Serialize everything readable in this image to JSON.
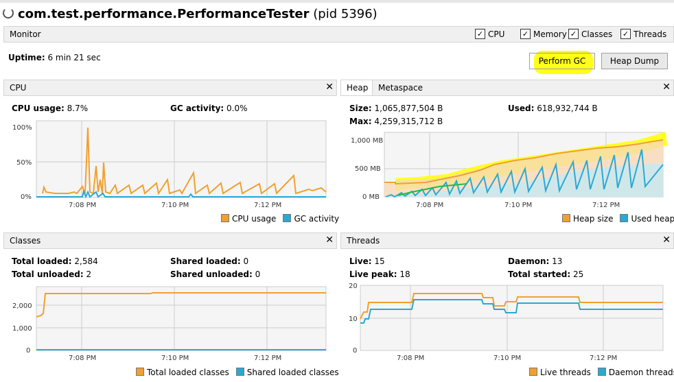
{
  "window": {
    "process": "com.test.performance.PerformanceTester",
    "pid": "(pid 5396)"
  },
  "monitor": {
    "label": "Monitor",
    "checkboxes": [
      {
        "label": "CPU",
        "checked": true
      },
      {
        "label": "Memory",
        "checked": true
      },
      {
        "label": "Classes",
        "checked": true
      },
      {
        "label": "Threads",
        "checked": true
      }
    ],
    "uptime_label": "Uptime:",
    "uptime_value": "6 min 21 sec",
    "perform_gc": "Perform GC",
    "heap_dump": "Heap Dump"
  },
  "cpu": {
    "title": "CPU",
    "usage_label": "CPU usage:",
    "usage_value": "8.7%",
    "gc_label": "GC activity:",
    "gc_value": "0.0%",
    "y_ticks": [
      "100%",
      "50%",
      "0%"
    ],
    "x_ticks": [
      "7:08 PM",
      "7:10 PM",
      "7:12 PM"
    ],
    "legend": [
      "CPU usage",
      "GC activity"
    ]
  },
  "heap": {
    "tabs": [
      "Heap",
      "Metaspace"
    ],
    "size_label": "Size:",
    "size_value": "1,065,877,504 B",
    "used_label": "Used:",
    "used_value": "618,932,744 B",
    "max_label": "Max:",
    "max_value": "4,259,315,712 B",
    "y_ticks": [
      "1,000 MB",
      "500 MB",
      "0 MB"
    ],
    "x_ticks": [
      "7:08 PM",
      "7:10 PM",
      "7:12 PM"
    ],
    "legend": [
      "Heap size",
      "Used heap"
    ]
  },
  "classes": {
    "title": "Classes",
    "total_loaded_label": "Total loaded:",
    "total_loaded_value": "2,584",
    "total_unloaded_label": "Total unloaded:",
    "total_unloaded_value": "2",
    "shared_loaded_label": "Shared loaded:",
    "shared_loaded_value": "0",
    "shared_unloaded_label": "Shared unloaded:",
    "shared_unloaded_value": "0",
    "y_ticks": [
      "2,000",
      "1,000",
      "0"
    ],
    "x_ticks": [
      "7:08 PM",
      "7:10 PM",
      "7:12 PM"
    ],
    "legend": [
      "Total loaded classes",
      "Shared loaded classes"
    ]
  },
  "threads": {
    "title": "Threads",
    "live_label": "Live:",
    "live_value": "15",
    "live_peak_label": "Live peak:",
    "live_peak_value": "18",
    "daemon_label": "Daemon:",
    "daemon_value": "13",
    "total_started_label": "Total started:",
    "total_started_value": "25",
    "y_ticks": [
      "20",
      "10",
      "0"
    ],
    "x_ticks": [
      "7:08 PM",
      "7:10 PM",
      "7:12 PM"
    ],
    "legend": [
      "Live threads",
      "Daemon threads"
    ]
  },
  "colors": {
    "orange": "#f0a030",
    "blue": "#29a9d4",
    "highlight": "#ffff00"
  }
}
